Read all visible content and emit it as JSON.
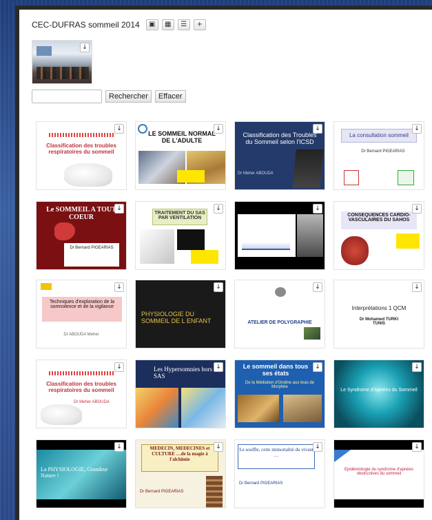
{
  "header": {
    "title": "CEC-DUFRAS sommeil 2014",
    "views": [
      {
        "icon": "image-view-icon",
        "glyph": "▣"
      },
      {
        "icon": "grid-view-icon",
        "glyph": "▦"
      },
      {
        "icon": "list-view-icon",
        "glyph": "☰"
      },
      {
        "icon": "add-icon",
        "glyph": "+"
      }
    ]
  },
  "download_glyph": "↓",
  "search": {
    "value": "",
    "search_label": "Rechercher",
    "clear_label": "Effacer"
  },
  "slides": [
    {
      "title": "Classification des troubles respiratoires du sommeil",
      "footer": ""
    },
    {
      "title": "LE SOMMEIL NORMAL DE L'ADULTE",
      "footer": ""
    },
    {
      "title": "Classification des Troubles du Sommeil selon l'ICSD",
      "footer": "Dr Meher ABOUDA"
    },
    {
      "title": "La consultation sommeil",
      "footer": "Dr Bernard PIGEARIAS"
    },
    {
      "title": "Le SOMMEIL A TOUT COEUR",
      "footer": "Dr Bernard PIGEARIAS"
    },
    {
      "title": "TRAITEMENT DU SAS PAR VENTILATION",
      "footer": ""
    },
    {
      "title": "",
      "footer": ""
    },
    {
      "title": "CONSEQUENCES CARDIO-VASCULAIRES DU SAHOS",
      "footer": ""
    },
    {
      "title": "Techniques d'exploration de la somnolence et de la vigilance",
      "footer": "Dr ABOUDA Meher"
    },
    {
      "title": "PHYSIOLOGIE DU SOMMEIL DE L ENFANT",
      "footer": ""
    },
    {
      "title": "ATELIER DE POLYGRAPHIE",
      "footer": ""
    },
    {
      "title": "Interprétations 1 QCM",
      "footer": "Dr Mohamed TURKI TUNIS"
    },
    {
      "title": "Classification des troubles respiratoires du sommeil",
      "footer": "Dr Meher ABOUDA"
    },
    {
      "title": "Les Hypersomnies hors SAS",
      "footer": ""
    },
    {
      "title": "Le sommeil dans tous ses états",
      "footer": "De la Médiation d'Ondine aux bras de Morphée"
    },
    {
      "title": "Le Syndrome d'Apnées du Sommeil",
      "footer": ""
    },
    {
      "title": "La PHYSIOLOGIE, Grandeur Nature !",
      "footer": ""
    },
    {
      "title": "MEDECIN, MEDECINES et CULTURE …de la magie à l'alchimie",
      "footer": "Dr Bernard PIGEARIAS"
    },
    {
      "title": "Le souffle, cette immortalité du vivant …",
      "footer": "Dr Bernard PIGEARIAS"
    },
    {
      "title": "Epidémiologie du syndrome d'apnées obstructives du sommeil",
      "footer": ""
    }
  ]
}
